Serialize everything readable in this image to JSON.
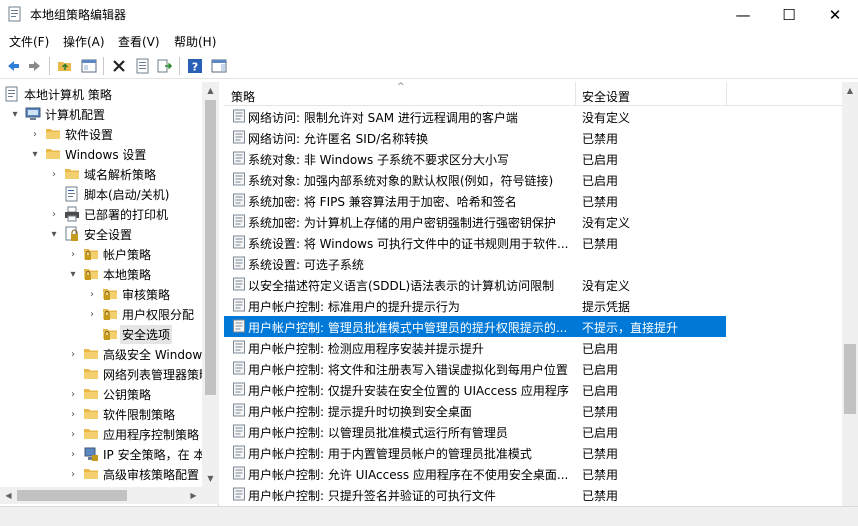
{
  "window": {
    "title": "本地组策略编辑器",
    "minimize_glyph": "—",
    "maximize_glyph": "☐",
    "close_glyph": "✕"
  },
  "menu": [
    {
      "label": "文件(F)"
    },
    {
      "label": "操作(A)"
    },
    {
      "label": "查看(V)"
    },
    {
      "label": "帮助(H)"
    }
  ],
  "toolbar": {
    "buttons": [
      "back-icon",
      "forward-icon",
      "up-folder-icon",
      "show-hide-tree-icon",
      "delete-icon",
      "properties-icon",
      "export-list-icon",
      "help-icon",
      "show-action-pane-icon"
    ]
  },
  "tree": [
    {
      "label": "本地计算机 策略",
      "icon": "computer-policy-icon",
      "arrow": ""
    },
    {
      "label": "计算机配置",
      "icon": "computer-icon",
      "arrow": "▾"
    },
    {
      "label": "软件设置",
      "icon": "folder-icon",
      "arrow": "›"
    },
    {
      "label": "Windows 设置",
      "icon": "folder-icon",
      "arrow": "▾"
    },
    {
      "label": "域名解析策略",
      "icon": "folder-icon",
      "arrow": "›"
    },
    {
      "label": "脚本(启动/关机)",
      "icon": "script-icon",
      "arrow": ""
    },
    {
      "label": "已部署的打印机",
      "icon": "printer-icon",
      "arrow": "›"
    },
    {
      "label": "安全设置",
      "icon": "security-icon",
      "arrow": "▾"
    },
    {
      "label": "帐户策略",
      "icon": "lock-folder-icon",
      "arrow": "›"
    },
    {
      "label": "本地策略",
      "icon": "lock-folder-icon",
      "arrow": "▾"
    },
    {
      "label": "审核策略",
      "icon": "lock-folder-icon",
      "arrow": "›"
    },
    {
      "label": "用户权限分配",
      "icon": "lock-folder-icon",
      "arrow": "›"
    },
    {
      "label": "安全选项",
      "icon": "lock-folder-icon",
      "arrow": ""
    },
    {
      "label": "高级安全 Windows",
      "icon": "folder-icon",
      "arrow": "›"
    },
    {
      "label": "网络列表管理器策略",
      "icon": "folder-icon",
      "arrow": ""
    },
    {
      "label": "公钥策略",
      "icon": "folder-icon",
      "arrow": "›"
    },
    {
      "label": "软件限制策略",
      "icon": "folder-icon",
      "arrow": "›"
    },
    {
      "label": "应用程序控制策略",
      "icon": "folder-icon",
      "arrow": "›"
    },
    {
      "label": "IP 安全策略，在 本",
      "icon": "ip-security-icon",
      "arrow": "›"
    },
    {
      "label": "高级审核策略配置",
      "icon": "folder-icon",
      "arrow": "›"
    }
  ],
  "list": {
    "col_policy": "策略",
    "col_setting": "安全设置",
    "sort_glyph": "^",
    "rows": [
      {
        "name": "网络访问: 限制允许对 SAM 进行远程调用的客户端",
        "value": "没有定义"
      },
      {
        "name": "网络访问: 允许匿名 SID/名称转换",
        "value": "已禁用"
      },
      {
        "name": "系统对象: 非 Windows 子系统不要求区分大小写",
        "value": "已启用"
      },
      {
        "name": "系统对象: 加强内部系统对象的默认权限(例如，符号链接)",
        "value": "已启用"
      },
      {
        "name": "系统加密: 将 FIPS 兼容算法用于加密、哈希和签名",
        "value": "已禁用"
      },
      {
        "name": "系统加密: 为计算机上存储的用户密钥强制进行强密钥保护",
        "value": "没有定义"
      },
      {
        "name": "系统设置: 将 Windows 可执行文件中的证书规则用于软件...",
        "value": "已禁用"
      },
      {
        "name": "系统设置: 可选子系统",
        "value": ""
      },
      {
        "name": "以安全描述符定义语言(SDDL)语法表示的计算机访问限制",
        "value": "没有定义"
      },
      {
        "name": "用户帐户控制: 标准用户的提升提示行为",
        "value": "提示凭据"
      },
      {
        "name": "用户帐户控制: 管理员批准模式中管理员的提升权限提示的...",
        "value": "不提示，直接提升",
        "selected": true
      },
      {
        "name": "用户帐户控制: 检测应用程序安装并提示提升",
        "value": "已启用"
      },
      {
        "name": "用户帐户控制: 将文件和注册表写入错误虚拟化到每用户位置",
        "value": "已启用"
      },
      {
        "name": "用户帐户控制: 仅提升安装在安全位置的 UIAccess 应用程序",
        "value": "已启用"
      },
      {
        "name": "用户帐户控制: 提示提升时切换到安全桌面",
        "value": "已禁用"
      },
      {
        "name": "用户帐户控制: 以管理员批准模式运行所有管理员",
        "value": "已启用"
      },
      {
        "name": "用户帐户控制: 用于内置管理员帐户的管理员批准模式",
        "value": "已禁用"
      },
      {
        "name": "用户帐户控制: 允许 UIAccess 应用程序在不使用安全桌面...",
        "value": "已禁用"
      },
      {
        "name": "用户帐户控制: 只提升签名并验证的可执行文件",
        "value": "已禁用"
      }
    ]
  },
  "colors": {
    "selection": "#0078d7",
    "tree_selection": "#e5e5e5",
    "folder": "#e8b94a",
    "scroll_thumb": "#c2c2c2"
  }
}
